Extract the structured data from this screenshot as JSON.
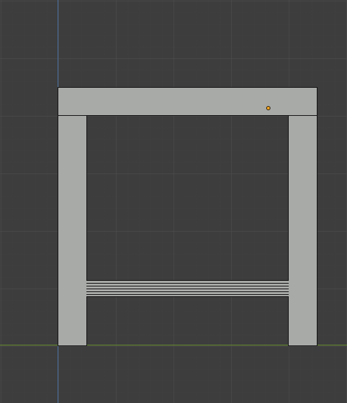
{
  "viewport": {
    "grid": true,
    "axes": [
      "y-axis",
      "x-axis"
    ],
    "colors": {
      "background": "#3d3d3d",
      "y_axis": "#4a6fa0",
      "x_axis": "#6a8f2f",
      "mesh": "#a8aaa8",
      "origin": "#f5a623"
    }
  },
  "object": {
    "parts": [
      "top-beam",
      "left-leg",
      "right-leg",
      "crossbar"
    ],
    "origin_marker": "origin-dot"
  }
}
